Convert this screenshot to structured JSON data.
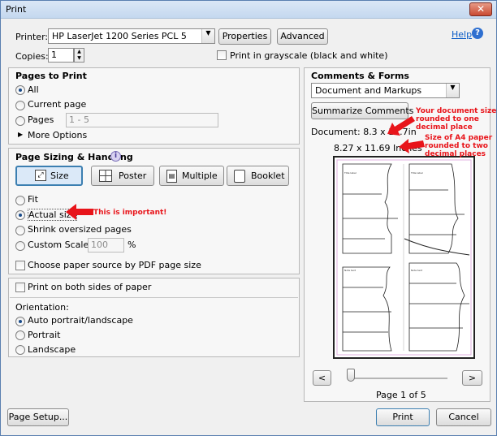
{
  "window": {
    "title": "Print",
    "close_glyph": "✕"
  },
  "help": {
    "label": "Help",
    "icon": "help-icon"
  },
  "printer": {
    "label": "Printer:",
    "value": "HP LaserJet 1200 Series PCL 5",
    "properties_button": "Properties",
    "advanced_button": "Advanced"
  },
  "copies": {
    "label": "Copies:",
    "value": "1"
  },
  "grayscale": {
    "label": "Print in grayscale (black and white)",
    "checked": false
  },
  "pages_to_print": {
    "title": "Pages to Print",
    "all": "All",
    "current_page": "Current page",
    "pages": "Pages",
    "pages_value": "1 - 5",
    "more_options": "More Options"
  },
  "sizing": {
    "title": "Page Sizing & Handling",
    "tabs": [
      "Size",
      "Poster",
      "Multiple",
      "Booklet"
    ],
    "fit": "Fit",
    "actual_size": "Actual size",
    "shrink": "Shrink oversized pages",
    "custom_scale": "Custom Scale:",
    "custom_scale_value": "100",
    "percent": "%",
    "paper_source": "Choose paper source by PDF page size"
  },
  "both_sides": {
    "label": "Print on both sides of paper"
  },
  "orientation": {
    "label": "Orientation:",
    "auto": "Auto portrait/landscape",
    "portrait": "Portrait",
    "landscape": "Landscape"
  },
  "comments_forms": {
    "title": "Comments & Forms",
    "value": "Document and Markups",
    "summarize_button": "Summarize Comments"
  },
  "document_size": "Document: 8.3 x 11.7in",
  "paper_size": "8.27 x 11.69 Inches",
  "annotations": {
    "important": "This is important!",
    "doc_size_note": [
      "Your document size",
      "rounded to one",
      "decimal place"
    ],
    "paper_note": [
      "Size of A4 paper",
      "rounded to two",
      "decimal places"
    ]
  },
  "navigation": {
    "prev": "<",
    "next": ">",
    "page_indicator": "Page 1 of 5"
  },
  "footer": {
    "page_setup": "Page Setup...",
    "print": "Print",
    "cancel": "Cancel"
  },
  "colors": {
    "annotation_red": "#e8141a",
    "link_blue": "#0b5cc7",
    "selected_tab": "#dbe9f8"
  }
}
